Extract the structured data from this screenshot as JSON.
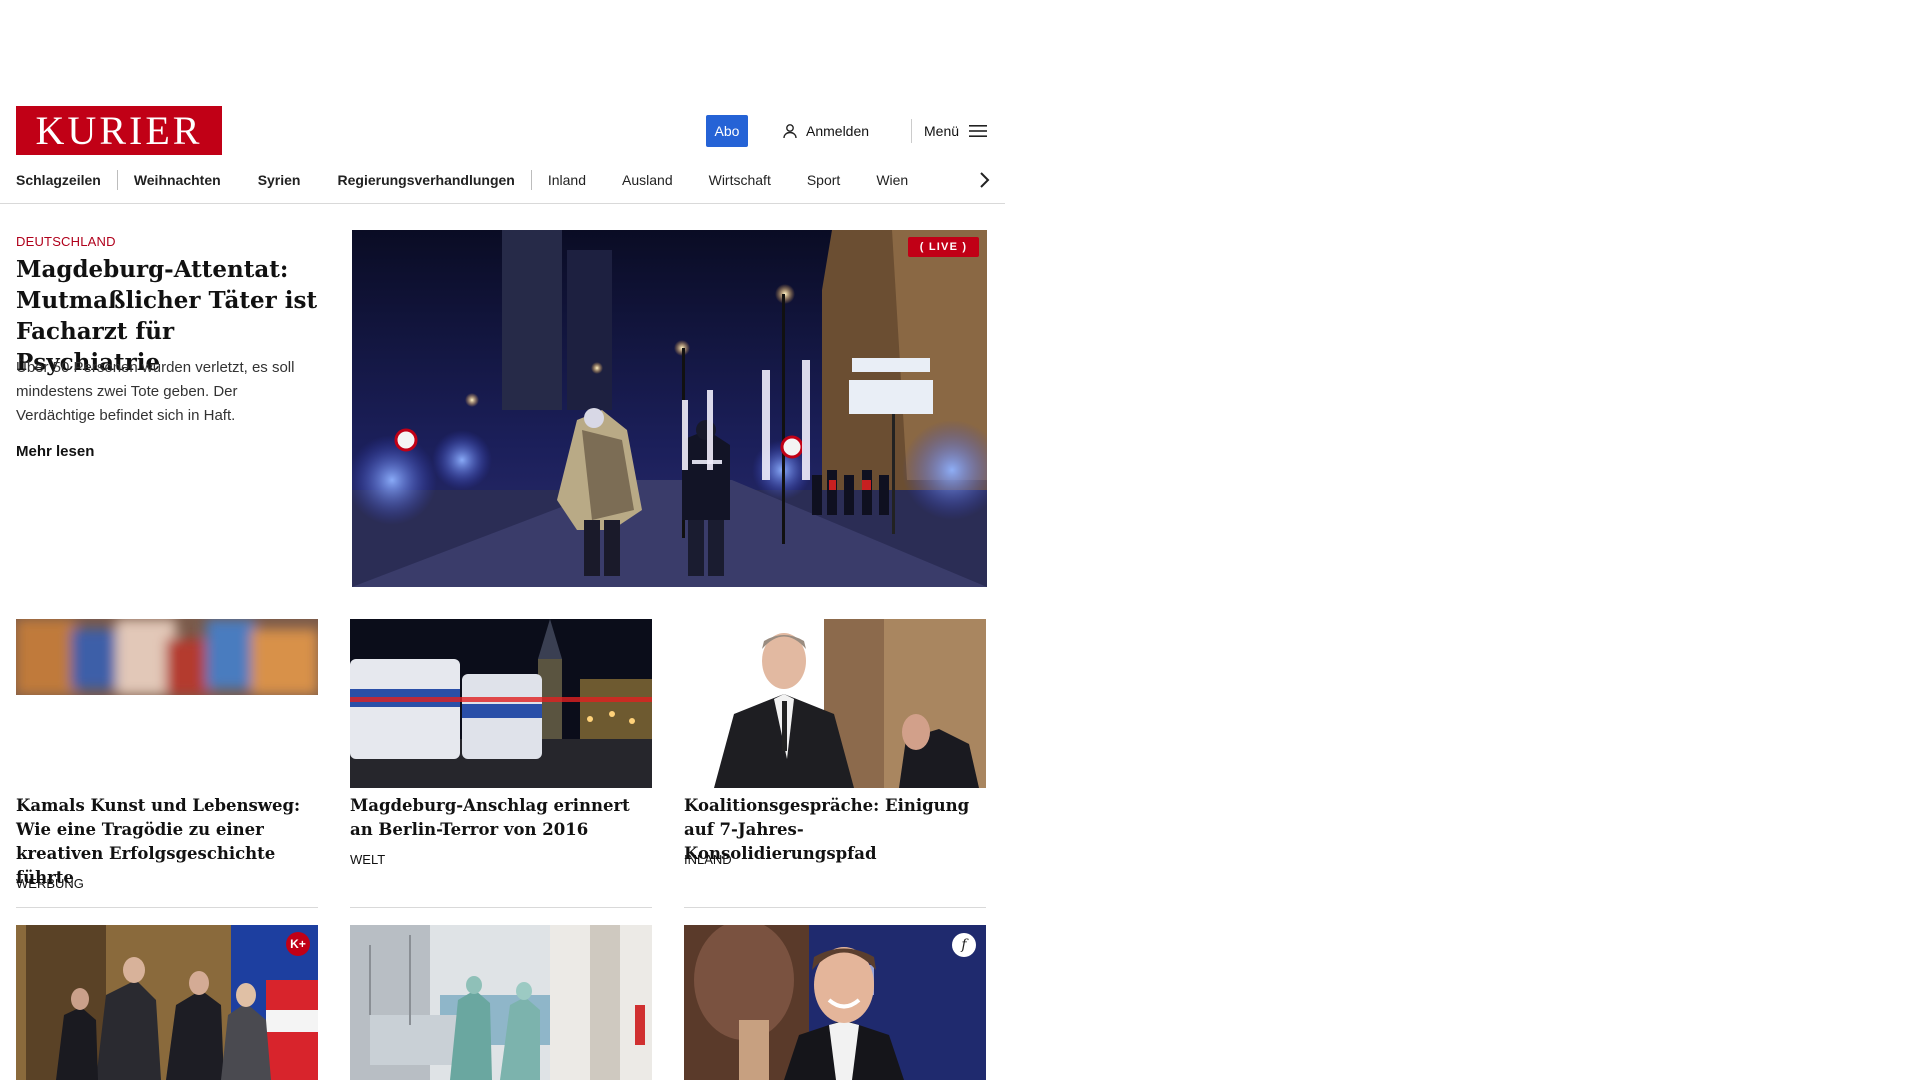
{
  "header": {
    "logo_text": "KURIER",
    "abo_label": "Abo",
    "login_label": "Anmelden",
    "menu_label": "Menü",
    "brand_color": "#c10016",
    "abo_color": "#2563d6"
  },
  "nav": {
    "items": [
      "Schlagzeilen",
      "Weihnachten",
      "Syrien",
      "Regierungsverhandlungen",
      "Inland",
      "Ausland",
      "Wirtschaft",
      "Sport",
      "Wien"
    ],
    "next_icon": "chevron-right-icon"
  },
  "lead": {
    "category": "DEUTSCHLAND",
    "title": "Magdeburg-Attentat: Mutmaßlicher Täter ist Facharzt für Psychiatrie",
    "teaser": "Über 50 Personen wurden verletzt, es soll mindestens zwei Tote geben. Der Verdächtige befindet sich in Haft.",
    "more_label": "Mehr lesen",
    "live_badge": "( LIVE )"
  },
  "row1": [
    {
      "title": "Kamals Kunst und Lebensweg: Wie eine Tragödie zu einer kreativen Erfolgsgeschichte führte",
      "category": "WERBUNG"
    },
    {
      "title": "Magdeburg-Anschlag erinnert an Berlin-Terror von 2016",
      "category": "WELT"
    },
    {
      "title": "Koalitionsgespräche: Einigung auf 7-Jahres-Konsolidierungspfad",
      "category": "INLAND"
    }
  ],
  "row2_badges": {
    "kplus": "K+",
    "f": "f"
  }
}
